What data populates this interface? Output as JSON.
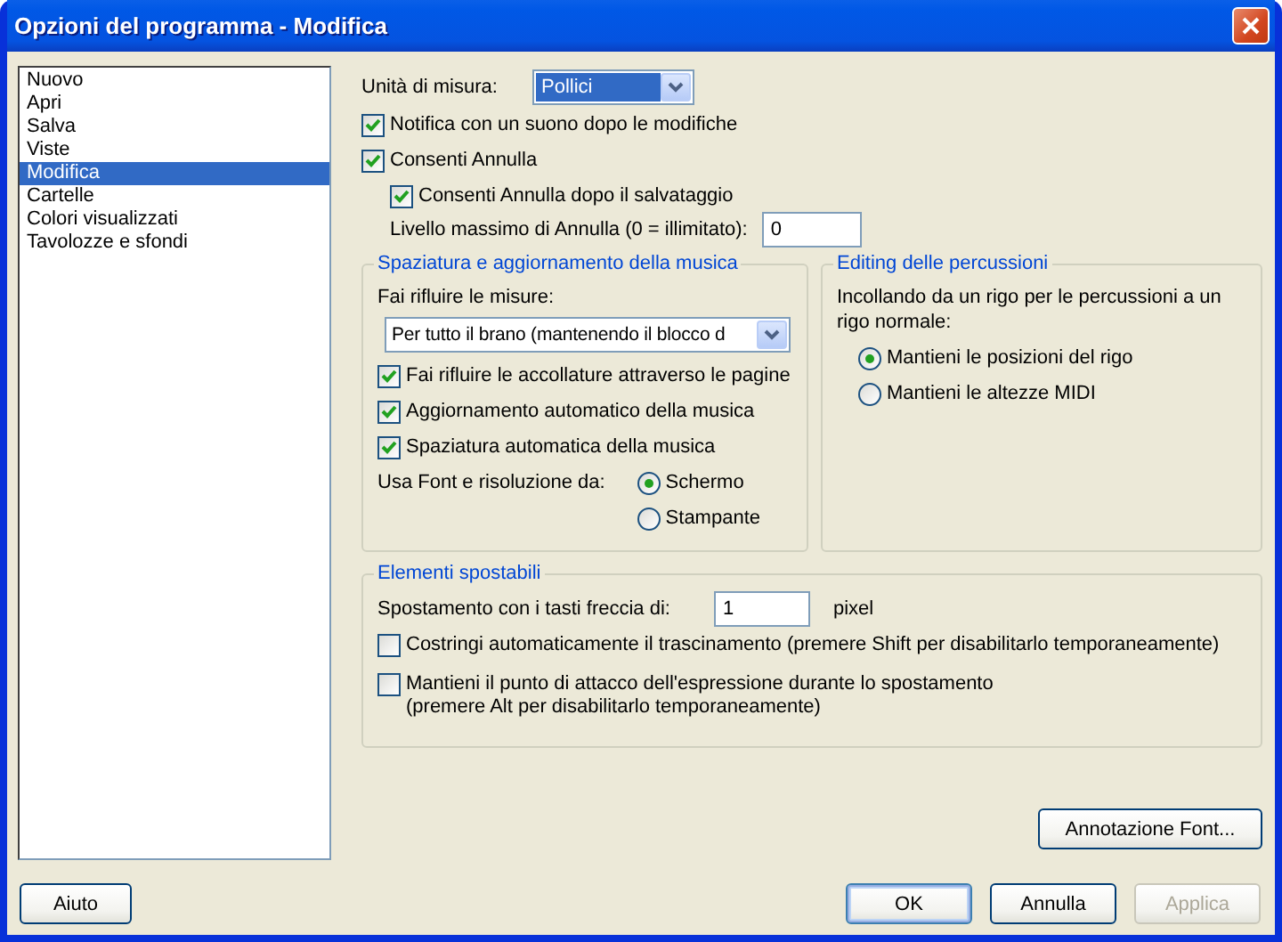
{
  "window": {
    "title": "Opzioni del programma - Modifica"
  },
  "sidebar": {
    "items": [
      {
        "label": "Nuovo",
        "selected": false
      },
      {
        "label": "Apri",
        "selected": false
      },
      {
        "label": "Salva",
        "selected": false
      },
      {
        "label": "Viste",
        "selected": false
      },
      {
        "label": "Modifica",
        "selected": true
      },
      {
        "label": "Cartelle",
        "selected": false
      },
      {
        "label": "Colori visualizzati",
        "selected": false
      },
      {
        "label": "Tavolozze e sfondi",
        "selected": false
      }
    ]
  },
  "units": {
    "label": "Unità di misura:",
    "value": "Pollici"
  },
  "options": [
    {
      "label": "Notifica con un suono dopo le modifiche",
      "checked": true
    },
    {
      "label": "Consenti Annulla",
      "checked": true,
      "children": [
        {
          "label": "Consenti Annulla dopo il salvataggio",
          "checked": true
        }
      ]
    }
  ],
  "undo_level": {
    "label": "Livello massimo di Annulla (0 = illimitato):",
    "value": "0"
  },
  "spacing_group": {
    "title": "Spaziatura e aggiornamento della musica",
    "reflow_label": "Fai rifluire le misure:",
    "reflow_value": "Per tutto il brano (mantenendo il blocco d",
    "checkboxes": [
      {
        "label": "Fai rifluire le accollature attraverso le pagine",
        "checked": true
      },
      {
        "label": "Aggiornamento automatico della musica",
        "checked": true
      },
      {
        "label": "Spaziatura automatica della musica",
        "checked": true
      }
    ],
    "font_label": "Usa Font e risoluzione da:",
    "font_source": [
      {
        "label": "Schermo",
        "selected": true
      },
      {
        "label": "Stampante",
        "selected": false
      }
    ]
  },
  "percussion_group": {
    "title": "Editing delle percussioni",
    "description": "Incollando da un rigo per le percussioni a un rigo normale:",
    "options": [
      {
        "label": "Mantieni le posizioni del rigo",
        "selected": true
      },
      {
        "label": "Mantieni le altezze MIDI",
        "selected": false
      }
    ]
  },
  "movable_group": {
    "title": "Elementi spostabili",
    "nudge_label": "Spostamento con i tasti freccia di:",
    "nudge_value": "1",
    "nudge_unit": "pixel",
    "checkboxes": [
      {
        "label": "Costringi automaticamente il trascinamento (premere Shift per disabilitarlo temporaneamente)",
        "checked": false
      },
      {
        "label": "Mantieni il punto di attacco dell'espressione durante lo spostamento\n(premere Alt per disabilitarlo temporaneamente)",
        "checked": false
      }
    ]
  },
  "font_button": {
    "label": "Annotazione Font..."
  },
  "footer": {
    "help": {
      "label": "Aiuto"
    },
    "actions": [
      {
        "label": "OK",
        "disabled": false,
        "focused": true
      },
      {
        "label": "Annulla",
        "disabled": false,
        "focused": false
      },
      {
        "label": "Applica",
        "disabled": true,
        "focused": false
      }
    ]
  }
}
